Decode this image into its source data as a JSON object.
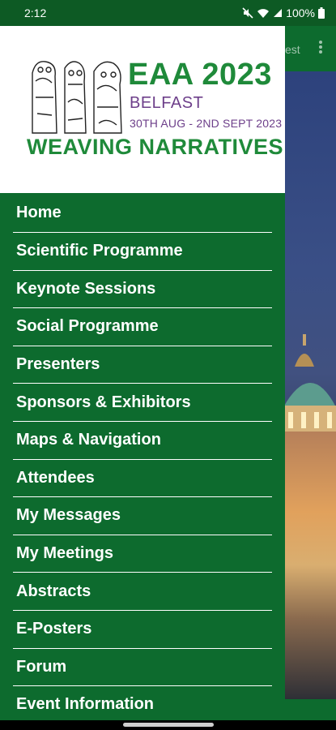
{
  "status_bar": {
    "time": "2:12",
    "battery": "100%",
    "icons": [
      "mute-icon",
      "wifi-icon",
      "signal-icon",
      "battery-icon"
    ]
  },
  "background_app": {
    "toolbar_partial_text": "est"
  },
  "drawer": {
    "logo": {
      "title": "EAA 2023",
      "city": "BELFAST",
      "dates": "30TH AUG - 2ND SEPT 2023",
      "tagline": "WEAVING NARRATIVES"
    },
    "items": [
      {
        "label": "Home"
      },
      {
        "label": "Scientific Programme"
      },
      {
        "label": "Keynote Sessions"
      },
      {
        "label": "Social Programme"
      },
      {
        "label": "Presenters"
      },
      {
        "label": "Sponsors & Exhibitors"
      },
      {
        "label": "Maps & Navigation"
      },
      {
        "label": "Attendees"
      },
      {
        "label": "My Messages"
      },
      {
        "label": "My Meetings"
      },
      {
        "label": "Abstracts"
      },
      {
        "label": "E-Posters"
      },
      {
        "label": "Forum"
      },
      {
        "label": "Event Information"
      }
    ]
  },
  "colors": {
    "drawer_bg": "#0d6b2e",
    "status_bar_bg": "#0d5a24",
    "logo_green": "#1f8a3a",
    "logo_purple": "#6d3f8a"
  }
}
